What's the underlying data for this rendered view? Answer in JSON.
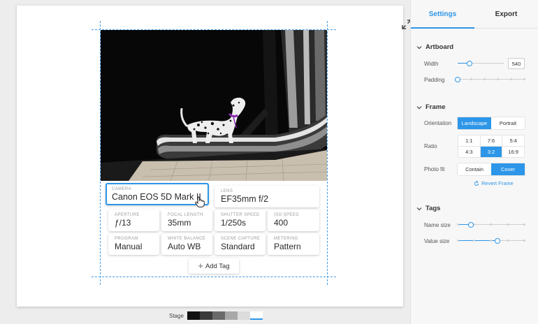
{
  "stage": {
    "label": "Stage",
    "swatches": [
      "#111111",
      "#3a3a3a",
      "#6a6a6a",
      "#a8a8a8",
      "#dcdcdc",
      "#ffffff"
    ],
    "active_index": 5
  },
  "tags": [
    {
      "label": "CAMERA",
      "value": "Canon EOS 5D Mark II",
      "selected": true
    },
    {
      "label": "LENS",
      "value": "EF35mm f/2"
    },
    {
      "label": "APERTURE",
      "value": "ƒ/13"
    },
    {
      "label": "FOCAL LENGTH",
      "value": "35mm"
    },
    {
      "label": "SHUTTER SPEED",
      "value": "1/250s"
    },
    {
      "label": "ISO SPEED",
      "value": "400"
    },
    {
      "label": "PROGRAM",
      "value": "Manual"
    },
    {
      "label": "WHITE BALANCE",
      "value": "Auto WB"
    },
    {
      "label": "SCENE CAPTURE",
      "value": "Standard"
    },
    {
      "label": "METERING",
      "value": "Pattern"
    }
  ],
  "add_tag_label": "Add Tag",
  "sidebar": {
    "tabs": [
      "Settings",
      "Export"
    ],
    "active_tab": "Settings",
    "artboard": {
      "title": "Artboard",
      "width_label": "Width",
      "width_value": "540",
      "width_slider": 0.25,
      "padding_label": "Padding",
      "padding_slider": 0.0
    },
    "frame": {
      "title": "Frame",
      "orientation_label": "Orientation",
      "orientation_options": [
        "Landscape",
        "Portrait"
      ],
      "orientation_selected": "Landscape",
      "ratio_label": "Ratio",
      "ratio_options": [
        "1:1",
        "7:6",
        "5:4",
        "4:3",
        "3:2",
        "16:9"
      ],
      "ratio_selected": "3:2",
      "photo_fit_label": "Photo fit",
      "photo_fit_options": [
        "Contain",
        "Cover"
      ],
      "photo_fit_selected": "Cover",
      "revert_label": "Revert Frame"
    },
    "tags_section": {
      "title": "Tags",
      "name_size_label": "Name size",
      "name_size_slider": 0.2,
      "value_size_label": "Value size",
      "value_size_slider": 0.6
    }
  },
  "colors": {
    "accent": "#2d96e8",
    "guide": "#3d9ae8"
  }
}
